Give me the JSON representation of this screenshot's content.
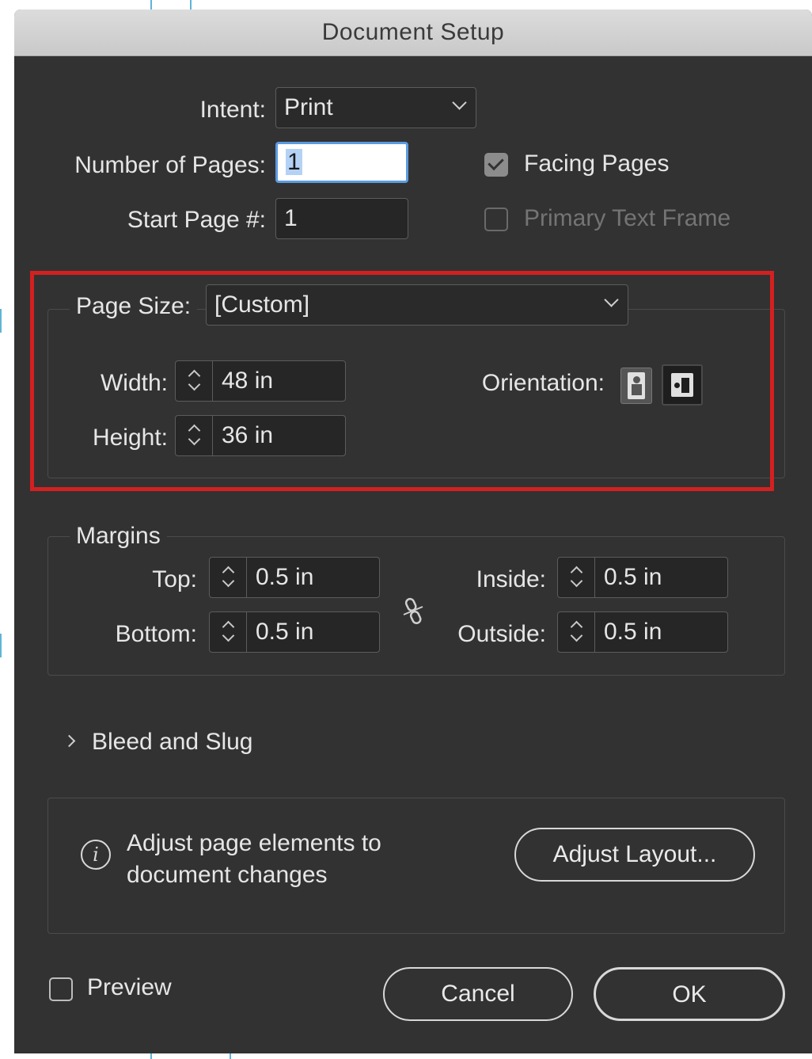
{
  "dialog": {
    "title": "Document Setup"
  },
  "intent": {
    "label": "Intent:",
    "value": "Print"
  },
  "pages": {
    "number_label": "Number of Pages:",
    "number_value": "1",
    "start_label": "Start Page #:",
    "start_value": "1"
  },
  "checkboxes": {
    "facing_pages": {
      "label": "Facing Pages",
      "checked": true
    },
    "primary_text_frame": {
      "label": "Primary Text Frame",
      "checked": false,
      "enabled": false
    }
  },
  "page_size": {
    "label": "Page Size:",
    "value": "[Custom]",
    "width_label": "Width:",
    "width_value": "48 in",
    "height_label": "Height:",
    "height_value": "36 in",
    "orientation_label": "Orientation:",
    "orientation_icons": [
      "portrait-icon",
      "landscape-icon"
    ],
    "selected_orientation": "landscape"
  },
  "margins": {
    "title": "Margins",
    "top_label": "Top:",
    "top_value": "0.5 in",
    "bottom_label": "Bottom:",
    "bottom_value": "0.5 in",
    "inside_label": "Inside:",
    "inside_value": "0.5 in",
    "outside_label": "Outside:",
    "outside_value": "0.5 in",
    "link_icon": "broken-chain-link-icon"
  },
  "bleed": {
    "label": "Bleed and Slug",
    "icon": "chevron-right-icon"
  },
  "adjust": {
    "info_line1": "Adjust page elements to",
    "info_line2": "document changes",
    "button_label": "Adjust Layout...",
    "icon": "info-icon"
  },
  "footer": {
    "preview_label": "Preview",
    "preview_checked": false,
    "cancel_label": "Cancel",
    "ok_label": "OK"
  },
  "colors": {
    "dialog_bg": "#323232",
    "highlight": "#d42020",
    "focus": "#5a9be0"
  }
}
